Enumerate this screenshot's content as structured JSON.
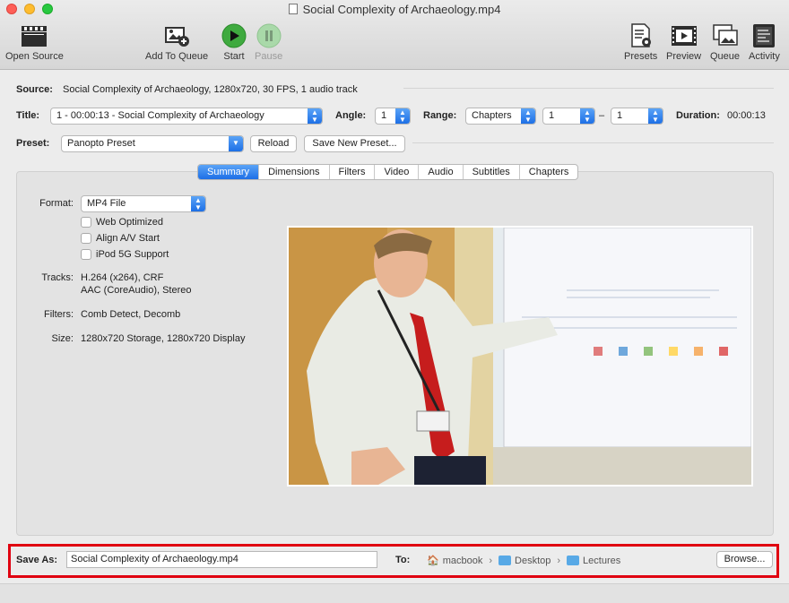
{
  "window": {
    "title": "Social Complexity of Archaeology.mp4"
  },
  "toolbar": {
    "open_source": "Open Source",
    "add_to_queue": "Add To Queue",
    "start": "Start",
    "pause": "Pause",
    "presets": "Presets",
    "preview": "Preview",
    "queue": "Queue",
    "activity": "Activity"
  },
  "source": {
    "label": "Source:",
    "value": "Social Complexity of Archaeology, 1280x720, 30 FPS, 1 audio track"
  },
  "title_row": {
    "title_label": "Title:",
    "title_value": "1 - 00:00:13 - Social Complexity of Archaeology",
    "angle_label": "Angle:",
    "angle_value": "1",
    "range_label": "Range:",
    "range_type": "Chapters",
    "range_start": "1",
    "range_dash": "–",
    "range_end": "1",
    "duration_label": "Duration:",
    "duration_value": "00:00:13"
  },
  "preset_row": {
    "label": "Preset:",
    "value": "Panopto Preset",
    "reload": "Reload",
    "save_new": "Save New Preset..."
  },
  "tabs": [
    "Summary",
    "Dimensions",
    "Filters",
    "Video",
    "Audio",
    "Subtitles",
    "Chapters"
  ],
  "summary": {
    "format_label": "Format:",
    "format_value": "MP4 File",
    "web_optimized": "Web Optimized",
    "align_av": "Align A/V Start",
    "ipod": "iPod 5G Support",
    "tracks_label": "Tracks:",
    "tracks_line1": "H.264 (x264), CRF",
    "tracks_line2": "AAC (CoreAudio), Stereo",
    "filters_label": "Filters:",
    "filters_value": "Comb Detect, Decomb",
    "size_label": "Size:",
    "size_value": "1280x720 Storage, 1280x720 Display"
  },
  "save": {
    "label": "Save As:",
    "filename": "Social Complexity of Archaeology.mp4",
    "to_label": "To:",
    "path": [
      "macbook",
      "Desktop",
      "Lectures"
    ],
    "browse": "Browse..."
  },
  "colors": {
    "accent": "#1d6fe6",
    "highlight_border": "#e00010"
  }
}
